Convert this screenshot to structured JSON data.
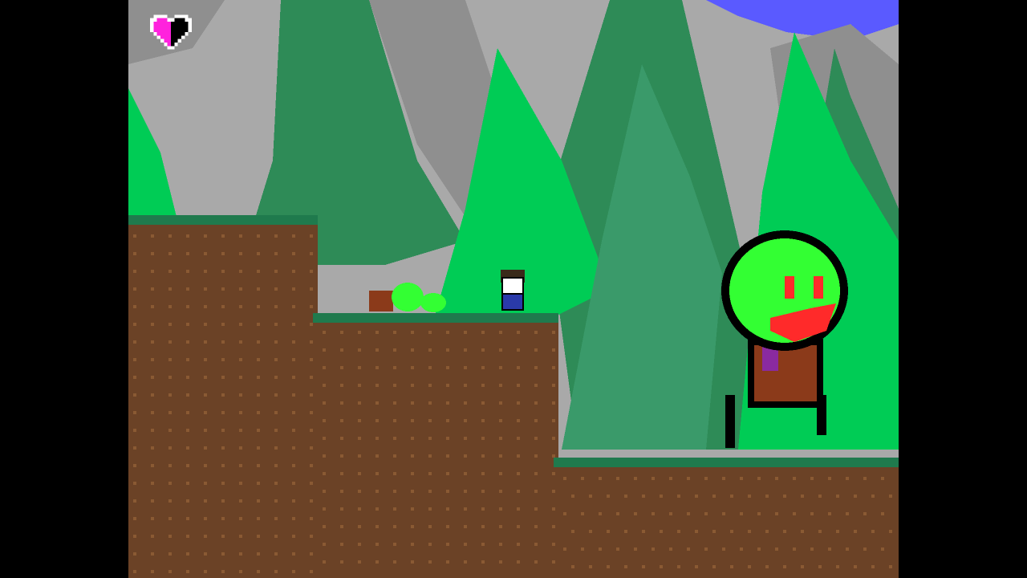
{
  "game": {
    "health": {
      "max_hearts": 1,
      "fill_fraction": 0.5,
      "fill_color": "#ff22dd",
      "empty_color": "#000000"
    },
    "palette": {
      "sky": "#5a5aff",
      "mountain_light": "#a9a9a9",
      "mountain_mid": "#8f8f8f",
      "tree_bright": "#00cc55",
      "tree_mid": "#2e8b57",
      "tree_dark": "#256b44",
      "tree_shade": "#3a9a6a",
      "grass": "#1f7a4d",
      "dirt": "#6b4226",
      "dirt_speck": "#8a5a33",
      "slime": "#33ff33",
      "boss_face": "#ff2a2a",
      "boss_body": "#8b3a1a",
      "boss_trim": "#8a2aa0"
    },
    "entities": {
      "player": "player-character",
      "boss": "slime-head-boss",
      "enemy_group": "slime-caterpillar-enemy"
    }
  }
}
